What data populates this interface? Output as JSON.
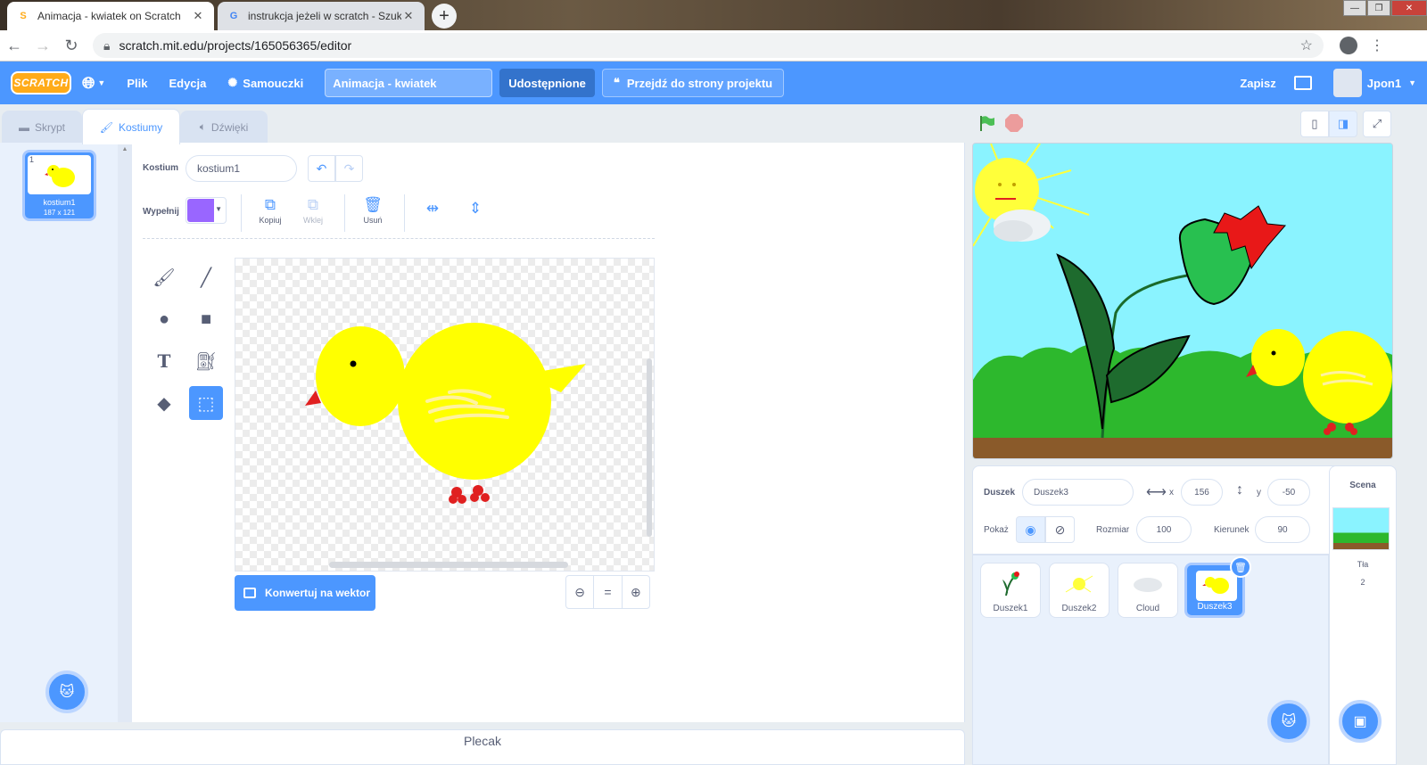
{
  "browser": {
    "tabs": [
      {
        "title": "Animacja - kwiatek on Scratch",
        "close": "✕"
      },
      {
        "title": "instrukcja jeżeli w scratch - Szuk",
        "close": "✕"
      }
    ],
    "new_tab": "+",
    "url": "scratch.mit.edu/projects/165056365/editor"
  },
  "menu": {
    "logo": "SCRATCH",
    "file": "Plik",
    "edit": "Edycja",
    "tutorials": "Samouczki",
    "project_title": "Animacja - kwiatek",
    "share": "Udostępnione",
    "see_project": "Przejdź do strony projektu",
    "save": "Zapisz",
    "username": "Jpon1"
  },
  "editor_tabs": {
    "code": "Skrypt",
    "costumes": "Kostiumy",
    "sounds": "Dźwięki"
  },
  "costumes": [
    {
      "number": "1",
      "name": "kostium1",
      "size": "187 x 121"
    }
  ],
  "paint": {
    "costume_label": "Kostium",
    "costume_name": "kostium1",
    "fill_label": "Wypełnij",
    "fill_color": "#9966ff",
    "copy": "Kopiuj",
    "paste": "Wklej",
    "delete": "Usuń",
    "convert": "Konwertuj na wektor",
    "zoom_reset": "="
  },
  "backpack": "Plecak",
  "sprite_info": {
    "sprite_label": "Duszek",
    "sprite_name": "Duszek3",
    "x_label": "x",
    "x": "156",
    "y_label": "y",
    "y": "-50",
    "show_label": "Pokaż",
    "size_label": "Rozmiar",
    "size": "100",
    "direction_label": "Kierunek",
    "direction": "90"
  },
  "sprites": [
    {
      "name": "Duszek1"
    },
    {
      "name": "Duszek2"
    },
    {
      "name": "Cloud"
    },
    {
      "name": "Duszek3"
    }
  ],
  "stage_pane": {
    "header": "Scena",
    "backdrops_label": "Tła",
    "backdrops_count": "2"
  },
  "colors": {
    "scratch_blue": "#4c97ff",
    "chick_yellow": "#ffff00",
    "grass_green": "#2db82d",
    "sky": "#8af3ff"
  }
}
